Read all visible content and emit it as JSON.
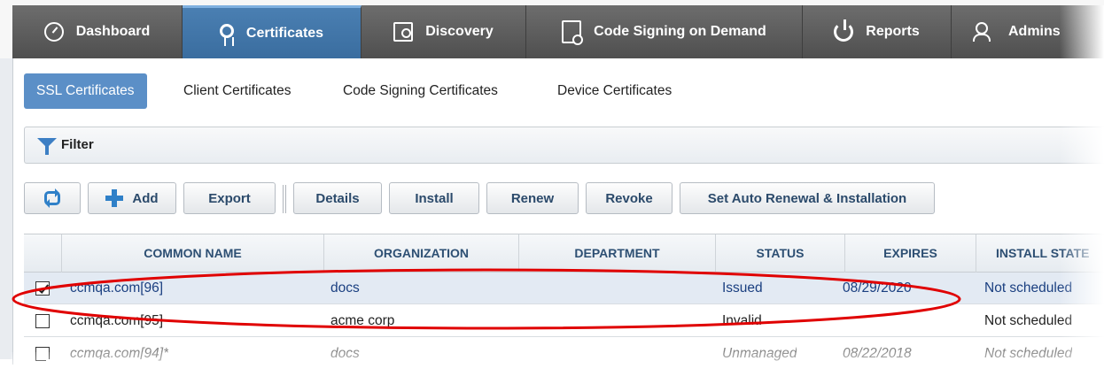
{
  "nav": {
    "tabs": [
      {
        "label": "Dashboard",
        "icon": "dashboard-icon"
      },
      {
        "label": "Certificates",
        "icon": "certificate-icon",
        "active": true
      },
      {
        "label": "Discovery",
        "icon": "discovery-icon"
      },
      {
        "label": "Code Signing on Demand",
        "icon": "code-signing-icon"
      },
      {
        "label": "Reports",
        "icon": "reports-icon"
      },
      {
        "label": "Admins",
        "icon": "admins-icon"
      }
    ]
  },
  "subtabs": [
    {
      "label": "SSL Certificates",
      "active": true
    },
    {
      "label": "Client Certificates"
    },
    {
      "label": "Code Signing Certificates"
    },
    {
      "label": "Device Certificates"
    }
  ],
  "filter": {
    "label": "Filter"
  },
  "toolbar": {
    "add": "Add",
    "export": "Export",
    "details": "Details",
    "install": "Install",
    "renew": "Renew",
    "revoke": "Revoke",
    "auto_renew": "Set Auto Renewal & Installation"
  },
  "table": {
    "columns": [
      "COMMON NAME",
      "ORGANIZATION",
      "DEPARTMENT",
      "STATUS",
      "EXPIRES",
      "INSTALL STATE"
    ],
    "rows": [
      {
        "checked": true,
        "common_name": "ccmqa.com[96]",
        "organization": "docs",
        "department": "",
        "status": "Issued",
        "expires": "08/29/2020",
        "install_state": "Not scheduled"
      },
      {
        "checked": false,
        "common_name": "ccmqa.com[95]",
        "organization": "acme corp",
        "department": "",
        "status": "Invalid",
        "expires": "",
        "install_state": "Not scheduled"
      },
      {
        "checked": false,
        "common_name": "ccmqa.com[94]*",
        "organization": "docs",
        "department": "",
        "status": "Unmanaged",
        "expires": "08/22/2018",
        "install_state": "Not scheduled"
      }
    ]
  },
  "colors": {
    "accent": "#5b8fc7",
    "annotation": "#e00000",
    "nav_bg": "#5a5a5a"
  }
}
